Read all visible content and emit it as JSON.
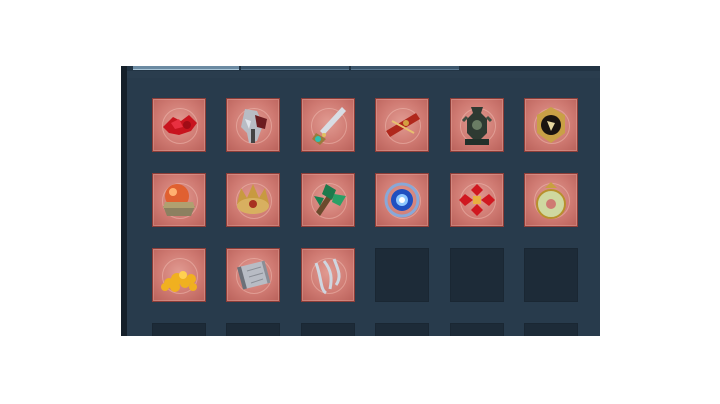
{
  "inventory": {
    "tabs": [
      "",
      "",
      ""
    ],
    "active_tab": 0,
    "slots": [
      {
        "item": "red-petals-icon",
        "filled": true
      },
      {
        "item": "axe-weapon-icon",
        "filled": true
      },
      {
        "item": "jeweled-sword-icon",
        "filled": true
      },
      {
        "item": "red-crossbow-icon",
        "filled": true
      },
      {
        "item": "bronze-vase-icon",
        "filled": true
      },
      {
        "item": "gold-seal-icon",
        "filled": true
      },
      {
        "item": "crystal-orb-icon",
        "filled": true
      },
      {
        "item": "golden-crown-icon",
        "filled": true
      },
      {
        "item": "jade-herb-icon",
        "filled": true
      },
      {
        "item": "blue-portal-icon",
        "filled": true
      },
      {
        "item": "chinese-knot-icon",
        "filled": true
      },
      {
        "item": "jade-disc-icon",
        "filled": true
      },
      {
        "item": "gold-ingots-icon",
        "filled": true
      },
      {
        "item": "scroll-icon",
        "filled": true
      },
      {
        "item": "silver-ribbon-icon",
        "filled": true
      },
      {
        "item": "",
        "filled": false
      },
      {
        "item": "",
        "filled": false
      },
      {
        "item": "",
        "filled": false
      },
      {
        "item": "",
        "filled": false
      },
      {
        "item": "",
        "filled": false
      },
      {
        "item": "",
        "filled": false
      },
      {
        "item": "",
        "filled": false
      },
      {
        "item": "",
        "filled": false
      },
      {
        "item": "",
        "filled": false
      }
    ]
  },
  "colors": {
    "panel": "#2a3d4e",
    "slot_filled": "#cf7a72",
    "slot_empty": "#1d2b38"
  }
}
